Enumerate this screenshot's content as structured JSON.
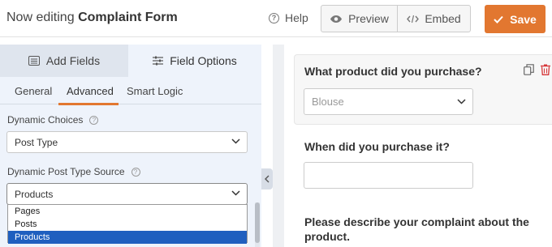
{
  "header": {
    "title_prefix": "Now editing",
    "title_name": "Complaint Form",
    "help_label": "Help",
    "preview_label": "Preview",
    "embed_label": "Embed",
    "save_label": "Save",
    "accent_color": "#e27730"
  },
  "panel": {
    "tabs": [
      {
        "label": "Add Fields",
        "icon": "list-icon"
      },
      {
        "label": "Field Options",
        "icon": "sliders-icon"
      }
    ],
    "subtabs": [
      "General",
      "Advanced",
      "Smart Logic"
    ],
    "active_subtab": "Advanced",
    "dynamic_choices": {
      "label": "Dynamic Choices",
      "value": "Post Type"
    },
    "dynamic_source": {
      "label": "Dynamic Post Type Source",
      "value": "Products",
      "options": [
        "Pages",
        "Posts",
        "Products"
      ],
      "highlighted": "Products"
    }
  },
  "form": {
    "q1": {
      "label": "What product did you purchase?",
      "value": "Blouse"
    },
    "q2": {
      "label": "When did you purchase it?"
    },
    "q3": {
      "label": "Please describe your complaint about the product."
    }
  }
}
